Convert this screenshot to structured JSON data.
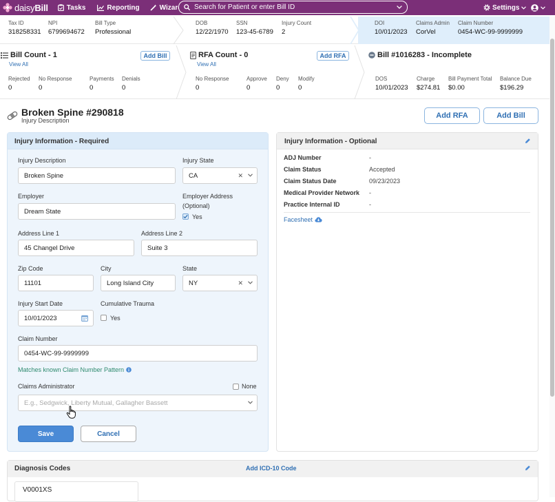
{
  "nav": {
    "logo_prefix": "daisy",
    "logo_bold": "Bill",
    "tasks": "Tasks",
    "reporting": "Reporting",
    "wizard": "Wizard",
    "search_placeholder": "Search for Patient or enter Bill ID",
    "settings": "Settings"
  },
  "colors": {
    "nav": "#7b2f78",
    "accent": "#2f6fb3",
    "save": "#4a8ad6",
    "teal_text": "#2e8a6e"
  },
  "practice": {
    "tax_id_label": "Tax ID",
    "tax_id": "318258331",
    "npi_label": "NPI",
    "npi": "6799694672",
    "bill_type_label": "Bill Type",
    "bill_type": "Professional"
  },
  "patient": {
    "dob_label": "DOB",
    "dob": "12/22/1970",
    "ssn_label": "SSN",
    "ssn": "123-45-6789",
    "injury_count_label": "Injury Count",
    "injury_count": "2"
  },
  "claim": {
    "doi_label": "DOI",
    "doi": "10/01/2023",
    "admin_label": "Claims Admin",
    "admin": "CorVel",
    "number_label": "Claim Number",
    "number": "0454-WC-99-9999999"
  },
  "bill_count": {
    "title": "Bill Count - 1",
    "view_all": "View All",
    "add": "Add Bill",
    "rejected_label": "Rejected",
    "rejected": "0",
    "no_response_label": "No Response",
    "no_response": "0",
    "payments_label": "Payments",
    "payments": "0",
    "denials_label": "Denials",
    "denials": "0"
  },
  "rfa_count": {
    "title": "RFA Count - 0",
    "view_all": "View All",
    "add": "Add RFA",
    "no_response_label": "No Response",
    "no_response": "0",
    "approve_label": "Approve",
    "approve": "0",
    "deny_label": "Deny",
    "deny": "0",
    "modify_label": "Modify",
    "modify": "0"
  },
  "bill": {
    "title": "Bill #1016283 - Incomplete",
    "dos_label": "DOS",
    "dos": "10/01/2023",
    "charge_label": "Charge",
    "charge": "$274.81",
    "payment_label": "Bill Payment Total",
    "payment": "$0.00",
    "balance_label": "Balance Due",
    "balance": "$196.29"
  },
  "injury": {
    "title": "Broken Spine #290818",
    "subtitle": "Injury Description",
    "add_rfa": "Add RFA",
    "add_bill": "Add Bill"
  },
  "form": {
    "header": "Injury Information - Required",
    "desc_label": "Injury Description",
    "desc": "Broken Spine",
    "state_label": "Injury State",
    "state": "CA",
    "employer_label": "Employer",
    "employer": "Dream State",
    "emp_addr_label_1": "Employer Address",
    "emp_addr_label_2": "(Optional)",
    "emp_addr_yes": "Yes",
    "addr1_label": "Address Line 1",
    "addr1": "45 Changel Drive",
    "addr2_label": "Address Line 2",
    "addr2": "Suite 3",
    "zip_label": "Zip Code",
    "zip": "11101",
    "city_label": "City",
    "city": "Long Island City",
    "state2_label": "State",
    "state2": "NY",
    "start_label": "Injury Start Date",
    "start": "10/01/2023",
    "cumulative_label": "Cumulative Trauma",
    "cumulative_yes": "Yes",
    "claim_label": "Claim Number",
    "claim": "0454-WC-99-9999999",
    "pattern_note": "Matches known Claim Number Pattern",
    "admin_label": "Claims Administrator",
    "admin_none": "None",
    "admin_placeholder": "E.g., Sedgwick, Liberty Mutual, Gallagher Bassett",
    "save": "Save",
    "cancel": "Cancel"
  },
  "optional": {
    "header": "Injury Information - Optional",
    "rows": [
      {
        "label": "ADJ Number",
        "value": "-"
      },
      {
        "label": "Claim Status",
        "value": "Accepted"
      },
      {
        "label": "Claim Status Date",
        "value": "09/23/2023"
      },
      {
        "label": "Medical Provider Network",
        "value": "-"
      },
      {
        "label": "Practice Internal ID",
        "value": "-"
      }
    ],
    "facesheet": "Facesheet"
  },
  "diagnosis": {
    "header": "Diagnosis Codes",
    "add": "Add ICD-10 Code",
    "code": "V0001XS"
  }
}
